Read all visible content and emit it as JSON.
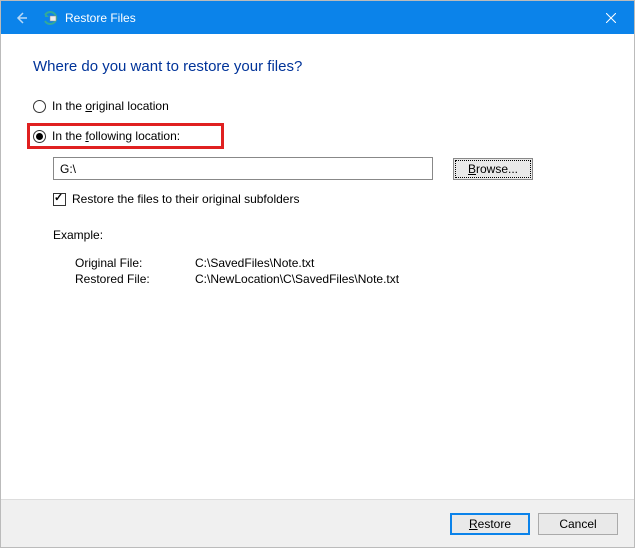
{
  "titlebar": {
    "title": "Restore Files"
  },
  "heading": "Where do you want to restore your files?",
  "radios": {
    "original_prefix": "In the ",
    "original_underline": "o",
    "original_suffix": "riginal location",
    "following_prefix": "In the ",
    "following_underline": "f",
    "following_suffix": "ollowing location:"
  },
  "path_value": "G:\\",
  "browse_label": "Browse...",
  "browse_underline": "B",
  "browse_rest": "rowse...",
  "checkbox_label": "Restore the files to their original subfolders",
  "example": {
    "label": "Example:",
    "original_file_label": "Original File:",
    "original_file_value": "C:\\SavedFiles\\Note.txt",
    "restored_file_label": "Restored File:",
    "restored_file_value": "C:\\NewLocation\\C\\SavedFiles\\Note.txt"
  },
  "footer": {
    "restore_underline": "R",
    "restore_rest": "estore",
    "cancel": "Cancel"
  }
}
